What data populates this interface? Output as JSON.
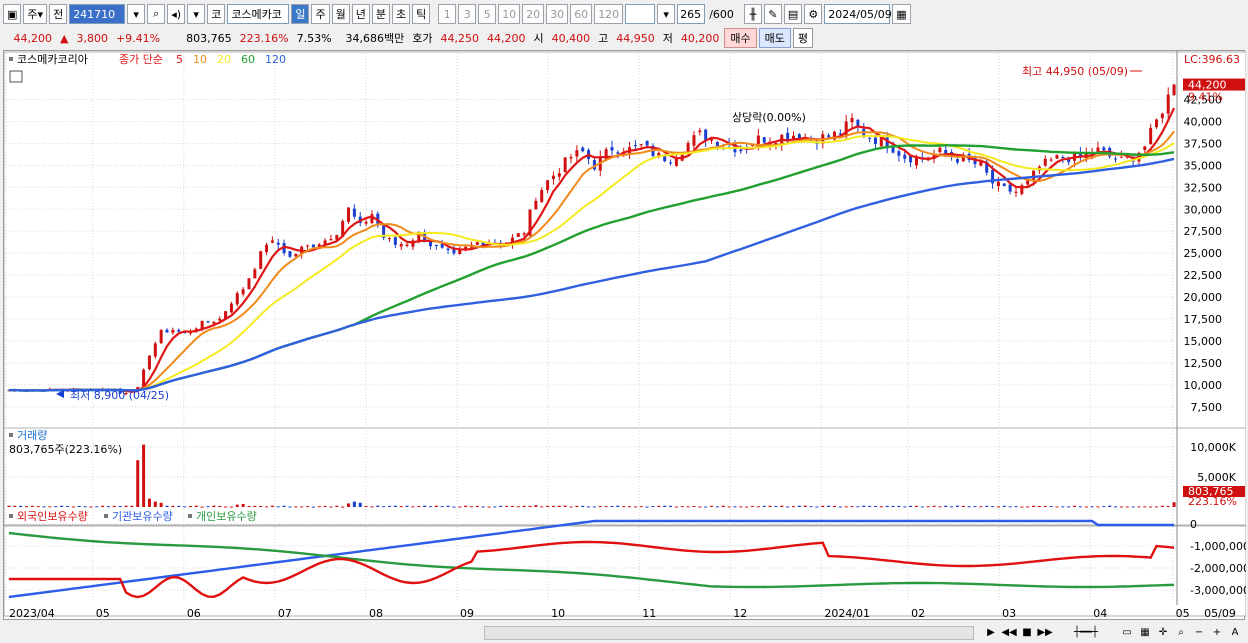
{
  "toolbar": {
    "market_label": "주",
    "period_label": "전",
    "code": "241710",
    "category_label": "코",
    "name": "코스메카코",
    "period_buttons": [
      "일",
      "주",
      "월",
      "년",
      "분",
      "초",
      "틱"
    ],
    "active_period": "일",
    "interval_buttons": [
      "1",
      "3",
      "5",
      "10",
      "20",
      "30",
      "60",
      "120"
    ],
    "bars_value": "265",
    "bars_total": "/600",
    "date": "2024/05/09"
  },
  "quote": {
    "price": "44,200",
    "arrow": "▲",
    "change": "3,800",
    "change_pct": "+9.41%",
    "volume": "803,765",
    "volume_ratio": "223.16%",
    "turnover": "7.53%",
    "amount": "34,686백만",
    "bid_label": "호가",
    "bid1": "44,250",
    "bid2": "44,200",
    "open_label": "시",
    "open": "40,400",
    "high_label": "고",
    "high": "44,950",
    "low_label": "저",
    "low": "40,200",
    "sell_label": "매수",
    "buy_label": "매도",
    "extra_label": "평"
  },
  "price_panel": {
    "stock_name": "코스메카코리아",
    "ma_title": "종가 단순",
    "ma_labels": [
      "5",
      "10",
      "20",
      "60",
      "120"
    ],
    "lc_label": "LC:396.63",
    "last_price": "44,200",
    "last_pct": "9.41%",
    "high_annot": "최고 44,950 (05/09)",
    "low_annot": "최저 8,900 (04/25)",
    "mid_annot": "상당락(0.00%)"
  },
  "volume_panel": {
    "title": "거래량",
    "subtitle": "803,765주(223.16%)",
    "last_volume": "803,765",
    "last_pct": "223.16%"
  },
  "holding_panel": {
    "series": [
      "외국인보유수량",
      "기관보유수량",
      "개인보유수량"
    ]
  },
  "x_axis_labels": [
    "2023/04",
    "05",
    "06",
    "07",
    "08",
    "09",
    "10",
    "11",
    "12",
    "2024/01",
    "02",
    "03",
    "04",
    "05",
    "05/09"
  ],
  "colors": {
    "up": "#d01010",
    "down": "#1a3fd0",
    "ma5": "#e01515",
    "ma10": "#f08a1a",
    "ma20": "#f4ea1e",
    "ma60": "#22a030",
    "ma120": "#3060e0",
    "foreign": "#e01010",
    "inst": "#2c5ce8",
    "indiv": "#2a9a40"
  },
  "chart_data": {
    "type": "candlestick",
    "price_axis": {
      "ticks": [
        7500,
        10000,
        12500,
        15000,
        17500,
        20000,
        22500,
        25000,
        27500,
        30000,
        32500,
        35000,
        37500,
        40000,
        42500
      ],
      "min": 6800,
      "max": 46200
    },
    "volume_axis": {
      "ticks": [
        "5,000K",
        "10,000K"
      ],
      "max": 12000
    },
    "holding_axis": {
      "ticks": [
        "0",
        "-1,000,000",
        "-2,000,000",
        "-3,000,000"
      ]
    },
    "price_anchors": [
      [
        0,
        9400
      ],
      [
        18,
        9500
      ],
      [
        19,
        9000
      ],
      [
        22,
        9600
      ],
      [
        24,
        13500
      ],
      [
        26,
        16000
      ],
      [
        28,
        16300
      ],
      [
        30,
        15800
      ],
      [
        33,
        17000
      ],
      [
        36,
        17500
      ],
      [
        38,
        19500
      ],
      [
        40,
        21000
      ],
      [
        42,
        23500
      ],
      [
        44,
        26200
      ],
      [
        46,
        26000
      ],
      [
        48,
        24500
      ],
      [
        50,
        25500
      ],
      [
        54,
        26500
      ],
      [
        56,
        27500
      ],
      [
        58,
        30000
      ],
      [
        60,
        28000
      ],
      [
        62,
        29500
      ],
      [
        64,
        26800
      ],
      [
        66,
        26000
      ],
      [
        68,
        26200
      ],
      [
        70,
        27200
      ],
      [
        72,
        26000
      ],
      [
        74,
        25300
      ],
      [
        76,
        24600
      ],
      [
        78,
        25500
      ],
      [
        80,
        26200
      ],
      [
        82,
        26400
      ],
      [
        84,
        26000
      ],
      [
        86,
        26600
      ],
      [
        88,
        27500
      ],
      [
        90,
        31500
      ],
      [
        92,
        33200
      ],
      [
        94,
        34600
      ],
      [
        96,
        36000
      ],
      [
        98,
        36500
      ],
      [
        100,
        35000
      ],
      [
        103,
        37000
      ],
      [
        106,
        36800
      ],
      [
        108,
        37200
      ],
      [
        111,
        36000
      ],
      [
        113,
        35800
      ],
      [
        116,
        37500
      ],
      [
        118,
        38500
      ],
      [
        120,
        38000
      ],
      [
        122,
        37600
      ],
      [
        125,
        36800
      ],
      [
        128,
        38000
      ],
      [
        131,
        38200
      ],
      [
        134,
        38500
      ],
      [
        137,
        38000
      ],
      [
        140,
        38300
      ],
      [
        142,
        38700
      ],
      [
        144,
        40100
      ],
      [
        146,
        38500
      ],
      [
        148,
        38000
      ],
      [
        150,
        37500
      ],
      [
        153,
        36000
      ],
      [
        156,
        35800
      ],
      [
        159,
        36500
      ],
      [
        162,
        35800
      ],
      [
        164,
        35400
      ],
      [
        166,
        34900
      ],
      [
        168,
        33000
      ],
      [
        170,
        32200
      ],
      [
        172,
        32000
      ],
      [
        174,
        33000
      ],
      [
        176,
        34800
      ],
      [
        178,
        35500
      ],
      [
        180,
        36000
      ],
      [
        182,
        35800
      ],
      [
        184,
        36300
      ],
      [
        186,
        36700
      ],
      [
        188,
        36000
      ],
      [
        190,
        35500
      ],
      [
        192,
        36000
      ],
      [
        194,
        37200
      ],
      [
        196,
        40000
      ],
      [
        199,
        44200
      ]
    ],
    "volume_spikes": [
      [
        22,
        7800
      ],
      [
        23,
        10400
      ],
      [
        24,
        1400
      ],
      [
        25,
        900
      ],
      [
        26,
        700
      ],
      [
        39,
        400
      ],
      [
        40,
        500
      ],
      [
        58,
        600
      ],
      [
        59,
        900
      ],
      [
        60,
        700
      ],
      [
        90,
        300
      ],
      [
        199,
        803
      ]
    ]
  }
}
